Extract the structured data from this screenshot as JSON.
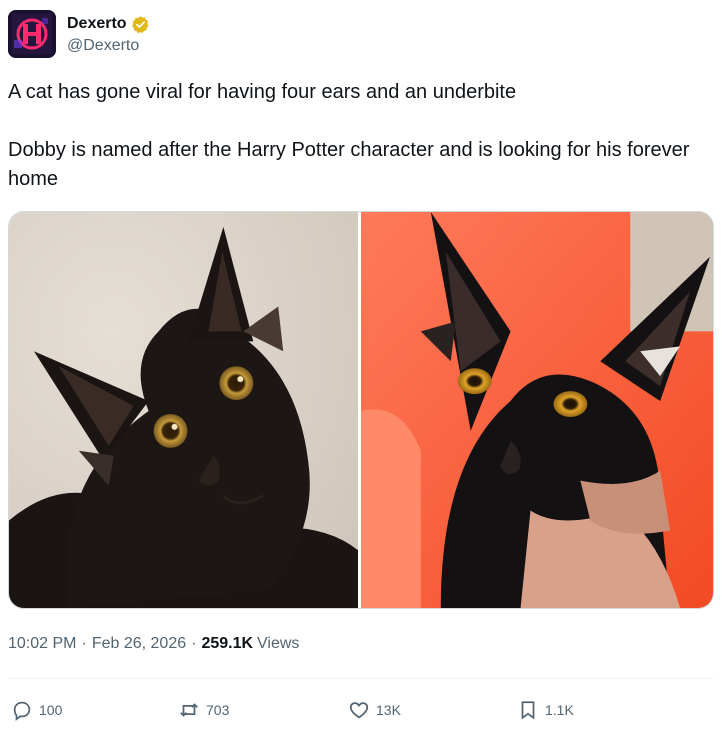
{
  "author": {
    "display_name": "Dexerto",
    "handle": "@Dexerto",
    "verified": true,
    "verified_color": "#e2b719",
    "avatar_icon": "dexerto-logo"
  },
  "tweet": {
    "line1": "A cat has gone viral for having four ears and an underbite",
    "line2": "Dobby is named after the Harry Potter character and is looking for his forever home"
  },
  "media": {
    "count": 2,
    "images": [
      "black-cat-photo-left",
      "black-cat-photo-right"
    ]
  },
  "meta": {
    "time": "10:02 PM",
    "separator": "·",
    "date": "Feb 26, 2026",
    "views_count": "259.1K",
    "views_label": "Views"
  },
  "actions": {
    "replies": "100",
    "reposts": "703",
    "likes": "13K",
    "bookmarks": "1.1K"
  },
  "colors": {
    "text": "#0f1419",
    "muted": "#536471",
    "avatar_bg": "#1a1030",
    "avatar_accent": "#ff2a6d"
  }
}
